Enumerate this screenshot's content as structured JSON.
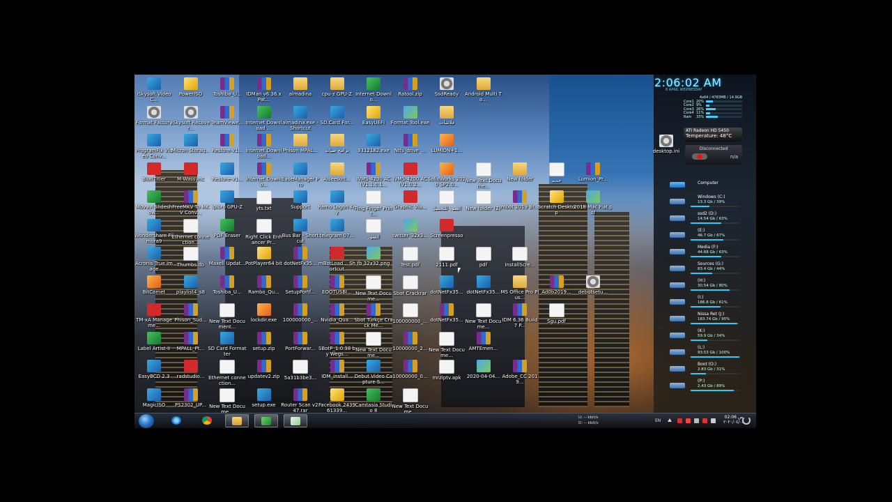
{
  "clock": {
    "time": "2:06:02 AM",
    "date": "8 APRIL WEDNESDAY"
  },
  "cpu": {
    "summary": "4x64 / 4783MB / 14.9GB",
    "rows": [
      {
        "name": "Core1",
        "pct": "20%",
        "value": 20
      },
      {
        "name": "Core2",
        "pct": "9%",
        "value": 9
      },
      {
        "name": "Core3",
        "pct": "26%",
        "value": 26
      },
      {
        "name": "Core4",
        "pct": "11%",
        "value": 11
      },
      {
        "name": "Ram",
        "pct": "33%",
        "value": 33
      }
    ]
  },
  "gpu": {
    "name": "ATI Radeon HD 5450",
    "temp": "Temperature: 48°C"
  },
  "network": {
    "status": "Disconnected",
    "value": "n/a"
  },
  "desktop_ini": "desktop.ini",
  "computer_label": "Computer",
  "drives": [
    {
      "name": "Windows (C:)",
      "info": "13.3 Gb / 39%",
      "fill": 39
    },
    {
      "name": "ssd2 (D:)",
      "info": "14.54 Gb / 63%",
      "fill": 63
    },
    {
      "name": "(E:)",
      "info": "46.7 Gb / 67%",
      "fill": 67
    },
    {
      "name": "Media (F:)",
      "info": "44.68 Gb / 63%",
      "fill": 63
    },
    {
      "name": "Sources (G:)",
      "info": "83.4 Gb / 44%",
      "fill": 44
    },
    {
      "name": "(H:)",
      "info": "30.54 Gb / 80%",
      "fill": 80
    },
    {
      "name": "(I:)",
      "info": "186.8 Gb / 61%",
      "fill": 61
    },
    {
      "name": "Nissa Ret (J:)",
      "info": "183.74 Gb / 95%",
      "fill": 95
    },
    {
      "name": "(K:)",
      "info": "59.9 Gb / 34%",
      "fill": 34
    },
    {
      "name": "(L:)",
      "info": "93.53 Gb / 100%",
      "fill": 100
    },
    {
      "name": "Boot (O:)",
      "info": "2.83 Gb / 31%",
      "fill": 31
    },
    {
      "name": "(P:)",
      "info": "2.43 Gb / 89%",
      "fill": 89
    }
  ],
  "desktop_icons": [
    {
      "label": "iSkysoft Video C...",
      "kind": "exe"
    },
    {
      "label": "PowerISO",
      "kind": "yellow"
    },
    {
      "label": "Toshiba_U...",
      "kind": "rar"
    },
    {
      "label": "IDMan v6.36.x Pat...",
      "kind": "rar"
    },
    {
      "label": "almadina",
      "kind": "folder"
    },
    {
      "label": "cpu-z GPU-Z",
      "kind": "folder"
    },
    {
      "label": "Internet Downlo...",
      "kind": "green"
    },
    {
      "label": "Ratool.zip",
      "kind": "rar"
    },
    {
      "label": "SsdReady",
      "kind": "gear"
    },
    {
      "label": "Android Multi To...",
      "kind": "folder"
    },
    {
      "label": "Format Factory",
      "kind": "gear"
    },
    {
      "label": "iSkysoft Recover...",
      "kind": "gear"
    },
    {
      "label": "TeamViewe...",
      "kind": "rar"
    },
    {
      "label": "Internet Download ...",
      "kind": "green"
    },
    {
      "label": "almadina.exe - Shortcut",
      "kind": "exe"
    },
    {
      "label": "SD.Card.For...",
      "kind": "exe"
    },
    {
      "label": "EasyUEFI",
      "kind": "yellow"
    },
    {
      "label": "Format Tool.exe",
      "kind": "img"
    },
    {
      "label": "فلاشات",
      "kind": "folder"
    },
    {
      "label": "ProgramFix Video Conv...",
      "kind": "exe"
    },
    {
      "label": "Micron Storag...",
      "kind": "exe"
    },
    {
      "label": "Restore-v1...",
      "kind": "rar"
    },
    {
      "label": "Internet Download...",
      "kind": "rar"
    },
    {
      "label": "Phison MPAL...",
      "kind": "folder"
    },
    {
      "label": "برامج صيانة",
      "kind": "folder"
    },
    {
      "label": "9312182.exe",
      "kind": "exe"
    },
    {
      "label": "Ntfs_drive_...",
      "kind": "rar"
    },
    {
      "label": "LUMION+1...",
      "kind": "orange"
    },
    {
      "label": "BluffTitler",
      "kind": "red"
    },
    {
      "label": "M-Wassync",
      "kind": "red"
    },
    {
      "label": "Restore-v1...",
      "kind": "exe"
    },
    {
      "label": "Internet Downlo...",
      "kind": "rar"
    },
    {
      "label": "EaseManager Pro",
      "kind": "exe"
    },
    {
      "label": "Aiseesoft...",
      "kind": "folder"
    },
    {
      "label": "IVMS-4200 AC(V1.1.0.1...",
      "kind": "rar"
    },
    {
      "label": "iVMS-4200 AC(V1.0.2...",
      "kind": "red"
    },
    {
      "label": "SolidWorks 2020 SP2.0...",
      "kind": "orange"
    },
    {
      "label": "New Text Docume...",
      "kind": "doc"
    },
    {
      "label": "New folder",
      "kind": "folder"
    },
    {
      "label": "جديد",
      "kind": "doc"
    },
    {
      "label": "Lumion_Pr...",
      "kind": "rar"
    },
    {
      "label": "Movavi Slideshow...",
      "kind": "green"
    },
    {
      "label": "FreeMKV To MKV Conv...",
      "kind": "rar"
    },
    {
      "label": "ipibro GPU-Z",
      "kind": "exe"
    },
    {
      "label": "yts.txt",
      "kind": "doc"
    },
    {
      "label": "Support",
      "kind": "exe"
    },
    {
      "label": "Remo Logon Key",
      "kind": "exe"
    },
    {
      "label": "Fing Finger Print...",
      "kind": "doc"
    },
    {
      "label": "Graphic Via...",
      "kind": "red"
    },
    {
      "label": "الصور للتحميل",
      "kind": "doc"
    },
    {
      "label": "New folder (2)",
      "kind": "doc"
    },
    {
      "label": "mbot 2019 Br...",
      "kind": "rar"
    },
    {
      "label": "Scratch Desktop",
      "kind": "yellow"
    },
    {
      "label": "2018 Mac Fiat.pdf",
      "kind": "img"
    },
    {
      "label": "Wondershare Filmora9",
      "kind": "exe"
    },
    {
      "label": "Ethernet connection...",
      "kind": "doc"
    },
    {
      "label": "PDF Eraser",
      "kind": "green"
    },
    {
      "label": "Right Click Enhancer Pr...",
      "kind": "doc"
    },
    {
      "label": "Bus Bar - Shortcut",
      "kind": "exe"
    },
    {
      "label": "telegram 07...",
      "kind": "exe"
    },
    {
      "label": "الصور",
      "kind": "doc"
    },
    {
      "label": "twitter_32x3...",
      "kind": "img"
    },
    {
      "label": "Screenpresso",
      "kind": "red"
    },
    {
      "label": "Acronis True Image",
      "kind": "exe"
    },
    {
      "label": "Thumbs.db",
      "kind": "doc"
    },
    {
      "label": "Maxell Updat...",
      "kind": "rar"
    },
    {
      "label": "PotPlayer64 bit",
      "kind": "yellow"
    },
    {
      "label": "dotNetFx35...",
      "kind": "rar"
    },
    {
      "label": "mBotLoad... Shortcut",
      "kind": "red"
    },
    {
      "label": "fb 32x32.png",
      "kind": "img"
    },
    {
      "label": "Test.pdf",
      "kind": "doc"
    },
    {
      "label": "2111.pdf",
      "kind": "doc"
    },
    {
      "label": "pdf",
      "kind": "doc"
    },
    {
      "label": "InstallScre...",
      "kind": "doc"
    },
    {
      "label": "BitComet",
      "kind": "orange"
    },
    {
      "label": "playlist4_s8",
      "kind": "exe"
    },
    {
      "label": "Toshiba_U...",
      "kind": "rar"
    },
    {
      "label": "Rambo_Qu...",
      "kind": "rar"
    },
    {
      "label": "SetupPortf...",
      "kind": "rar"
    },
    {
      "label": "EOOTUSBI...",
      "kind": "rar"
    },
    {
      "label": "New Text Docume...",
      "kind": "doc"
    },
    {
      "label": "Sbot Crackrar",
      "kind": "doc"
    },
    {
      "label": "dotNetFx35...",
      "kind": "exe"
    },
    {
      "label": "dotNetFx35...",
      "kind": "exe"
    },
    {
      "label": "MS Office Pro Plus...",
      "kind": "folder"
    },
    {
      "label": "Ad0b2019...",
      "kind": "rar"
    },
    {
      "label": "debutsetu...",
      "kind": "gear"
    },
    {
      "label": "TM-xA Manageme...",
      "kind": "red"
    },
    {
      "label": "Phison_Sud...",
      "kind": "rar"
    },
    {
      "label": "New Text Document...",
      "kind": "doc"
    },
    {
      "label": "lockdir.exe",
      "kind": "orange"
    },
    {
      "label": "100000000_...",
      "kind": "rar"
    },
    {
      "label": "Nvidia_Qua...",
      "kind": "rar"
    },
    {
      "label": "Sbot Türkçe Crack Me...",
      "kind": "rar"
    },
    {
      "label": "100000000_...",
      "kind": "doc"
    },
    {
      "label": "dotNetFx35...",
      "kind": "rar"
    },
    {
      "label": "New Text Docume...",
      "kind": "doc"
    },
    {
      "label": "IDM 6.36 Build 7 P...",
      "kind": "rar"
    },
    {
      "label": "Sgu.pdf",
      "kind": "doc"
    },
    {
      "label": "Label Artist-II",
      "kind": "green"
    },
    {
      "label": "MPALL_Pt...",
      "kind": "rar"
    },
    {
      "label": "SD Card Formatter",
      "kind": "exe"
    },
    {
      "label": "setup.zip",
      "kind": "rar"
    },
    {
      "label": "PortForwar...",
      "kind": "rar"
    },
    {
      "label": "SBotP_1.0.38 by Wegs...",
      "kind": "rar"
    },
    {
      "label": "New Text Docume...",
      "kind": "doc"
    },
    {
      "label": "10000000_2...",
      "kind": "rar"
    },
    {
      "label": "New Text Docume...",
      "kind": "doc"
    },
    {
      "label": "AMTEmen...",
      "kind": "rar"
    },
    {
      "label": "EasyBCD 2.3",
      "kind": "exe"
    },
    {
      "label": "radstudio...",
      "kind": "red"
    },
    {
      "label": "Ethernet connection...",
      "kind": "doc"
    },
    {
      "label": "updatev2.zip",
      "kind": "rar"
    },
    {
      "label": "5a31b3be3...",
      "kind": "doc"
    },
    {
      "label": "IDM_install...",
      "kind": "rar"
    },
    {
      "label": "Debut Video Capture S...",
      "kind": "exe"
    },
    {
      "label": "10000000_0...",
      "kind": "rar"
    },
    {
      "label": "mrzlptv.apk",
      "kind": "doc"
    },
    {
      "label": "2020-04-04...",
      "kind": "img"
    },
    {
      "label": "Adobe_CC 2019...",
      "kind": "rar"
    },
    {
      "label": "MagicISO",
      "kind": "exe"
    },
    {
      "label": "PS2302_UP...",
      "kind": "rar"
    },
    {
      "label": "New Text Docume...",
      "kind": "doc"
    },
    {
      "label": "setup.exe",
      "kind": "exe"
    },
    {
      "label": "Router Scan v2.47.rar",
      "kind": "rar"
    },
    {
      "label": "Facebook 243961339...",
      "kind": "yellow"
    },
    {
      "label": "Camtasia Studio 8",
      "kind": "green"
    },
    {
      "label": "New Text Docume...",
      "kind": "doc"
    }
  ],
  "taskbar": {
    "kb_up": "U: -- kbit/s",
    "kb_down": "D: -- kbit/s",
    "lang": "EN",
    "time": "02:06 ص",
    "date": "٢٠٢٠/٠٤/٠٨"
  }
}
